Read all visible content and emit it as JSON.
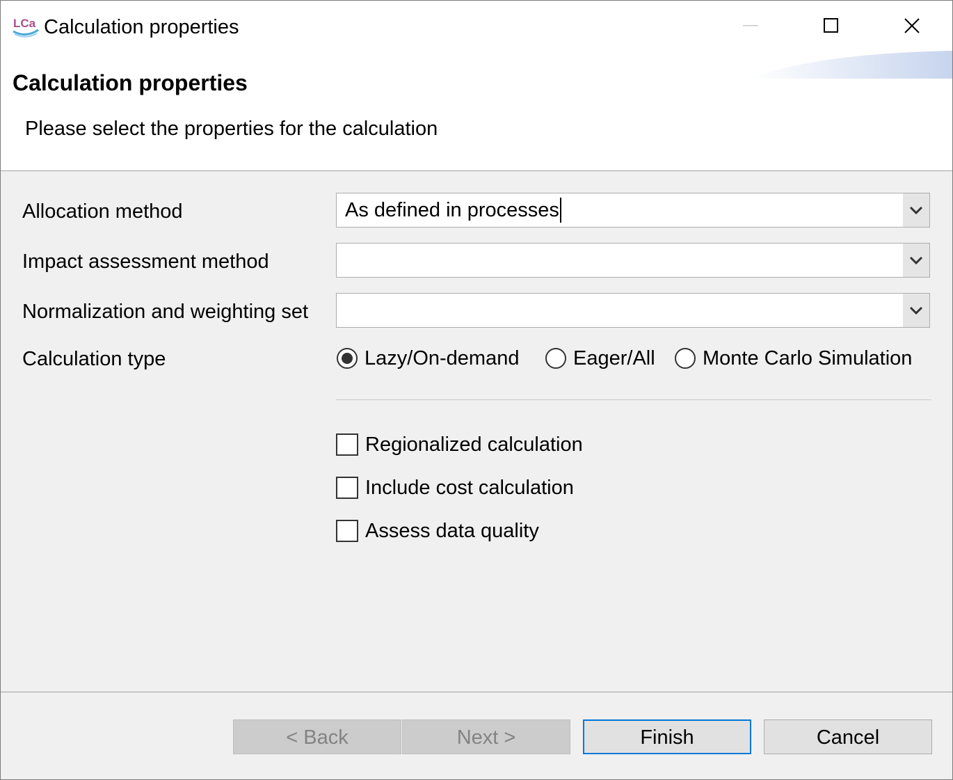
{
  "window": {
    "title": "Calculation properties",
    "app_icon": "lca-app-icon",
    "controls": {
      "minimize": "minimize-icon",
      "maximize": "maximize-icon",
      "close": "close-icon"
    }
  },
  "header": {
    "title": "Calculation properties",
    "description": "Please select the properties for the calculation"
  },
  "form": {
    "allocation_method": {
      "label": "Allocation method",
      "value": "As defined in processes"
    },
    "impact_assessment_method": {
      "label": "Impact assessment method",
      "value": ""
    },
    "normalization_weighting_set": {
      "label": "Normalization and weighting set",
      "value": ""
    },
    "calculation_type": {
      "label": "Calculation type",
      "options": [
        "Lazy/On-demand",
        "Eager/All",
        "Monte Carlo Simulation"
      ],
      "selected": "Lazy/On-demand"
    },
    "checkboxes": [
      {
        "label": "Regionalized calculation",
        "checked": false
      },
      {
        "label": "Include cost calculation",
        "checked": false
      },
      {
        "label": "Assess data quality",
        "checked": false
      }
    ]
  },
  "buttons": {
    "back": "< Back",
    "next": "Next >",
    "finish": "Finish",
    "cancel": "Cancel"
  },
  "colors": {
    "default_button_border": "#0078d7",
    "dialog_bg": "#f0f0f0"
  }
}
